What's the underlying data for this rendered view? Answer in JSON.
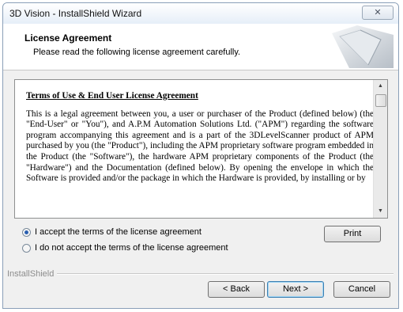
{
  "window": {
    "title": "3D Vision - InstallShield Wizard",
    "close_glyph": "✕"
  },
  "header": {
    "title": "License Agreement",
    "subtitle": "Please read the following license agreement carefully."
  },
  "license": {
    "heading": "Terms of Use & End User License Agreement",
    "body": "This is a legal agreement between you, a user or purchaser of the Product (defined below) (the \"End-User\" or \"You\"), and A.P.M Automation Solutions Ltd. (\"APM\") regarding the software program accompanying this agreement and is a part of the 3DLevelScanner product of APM purchased by you (the \"Product\"), including the APM proprietary software program embedded in the Product (the \"Software\"), the hardware APM proprietary components of the Product (the \"Hardware\") and the Documentation (defined below). By opening the envelope in which the Software is provided and/or the package in which the Hardware is provided, by installing or by"
  },
  "options": {
    "accept_label": "I accept the terms of the license agreement",
    "decline_label": "I do not accept the terms of the license agreement",
    "selected": "accept"
  },
  "buttons": {
    "print": "Print",
    "back": "< Back",
    "next": "Next >",
    "cancel": "Cancel"
  },
  "footer": {
    "brand": "InstallShield"
  }
}
